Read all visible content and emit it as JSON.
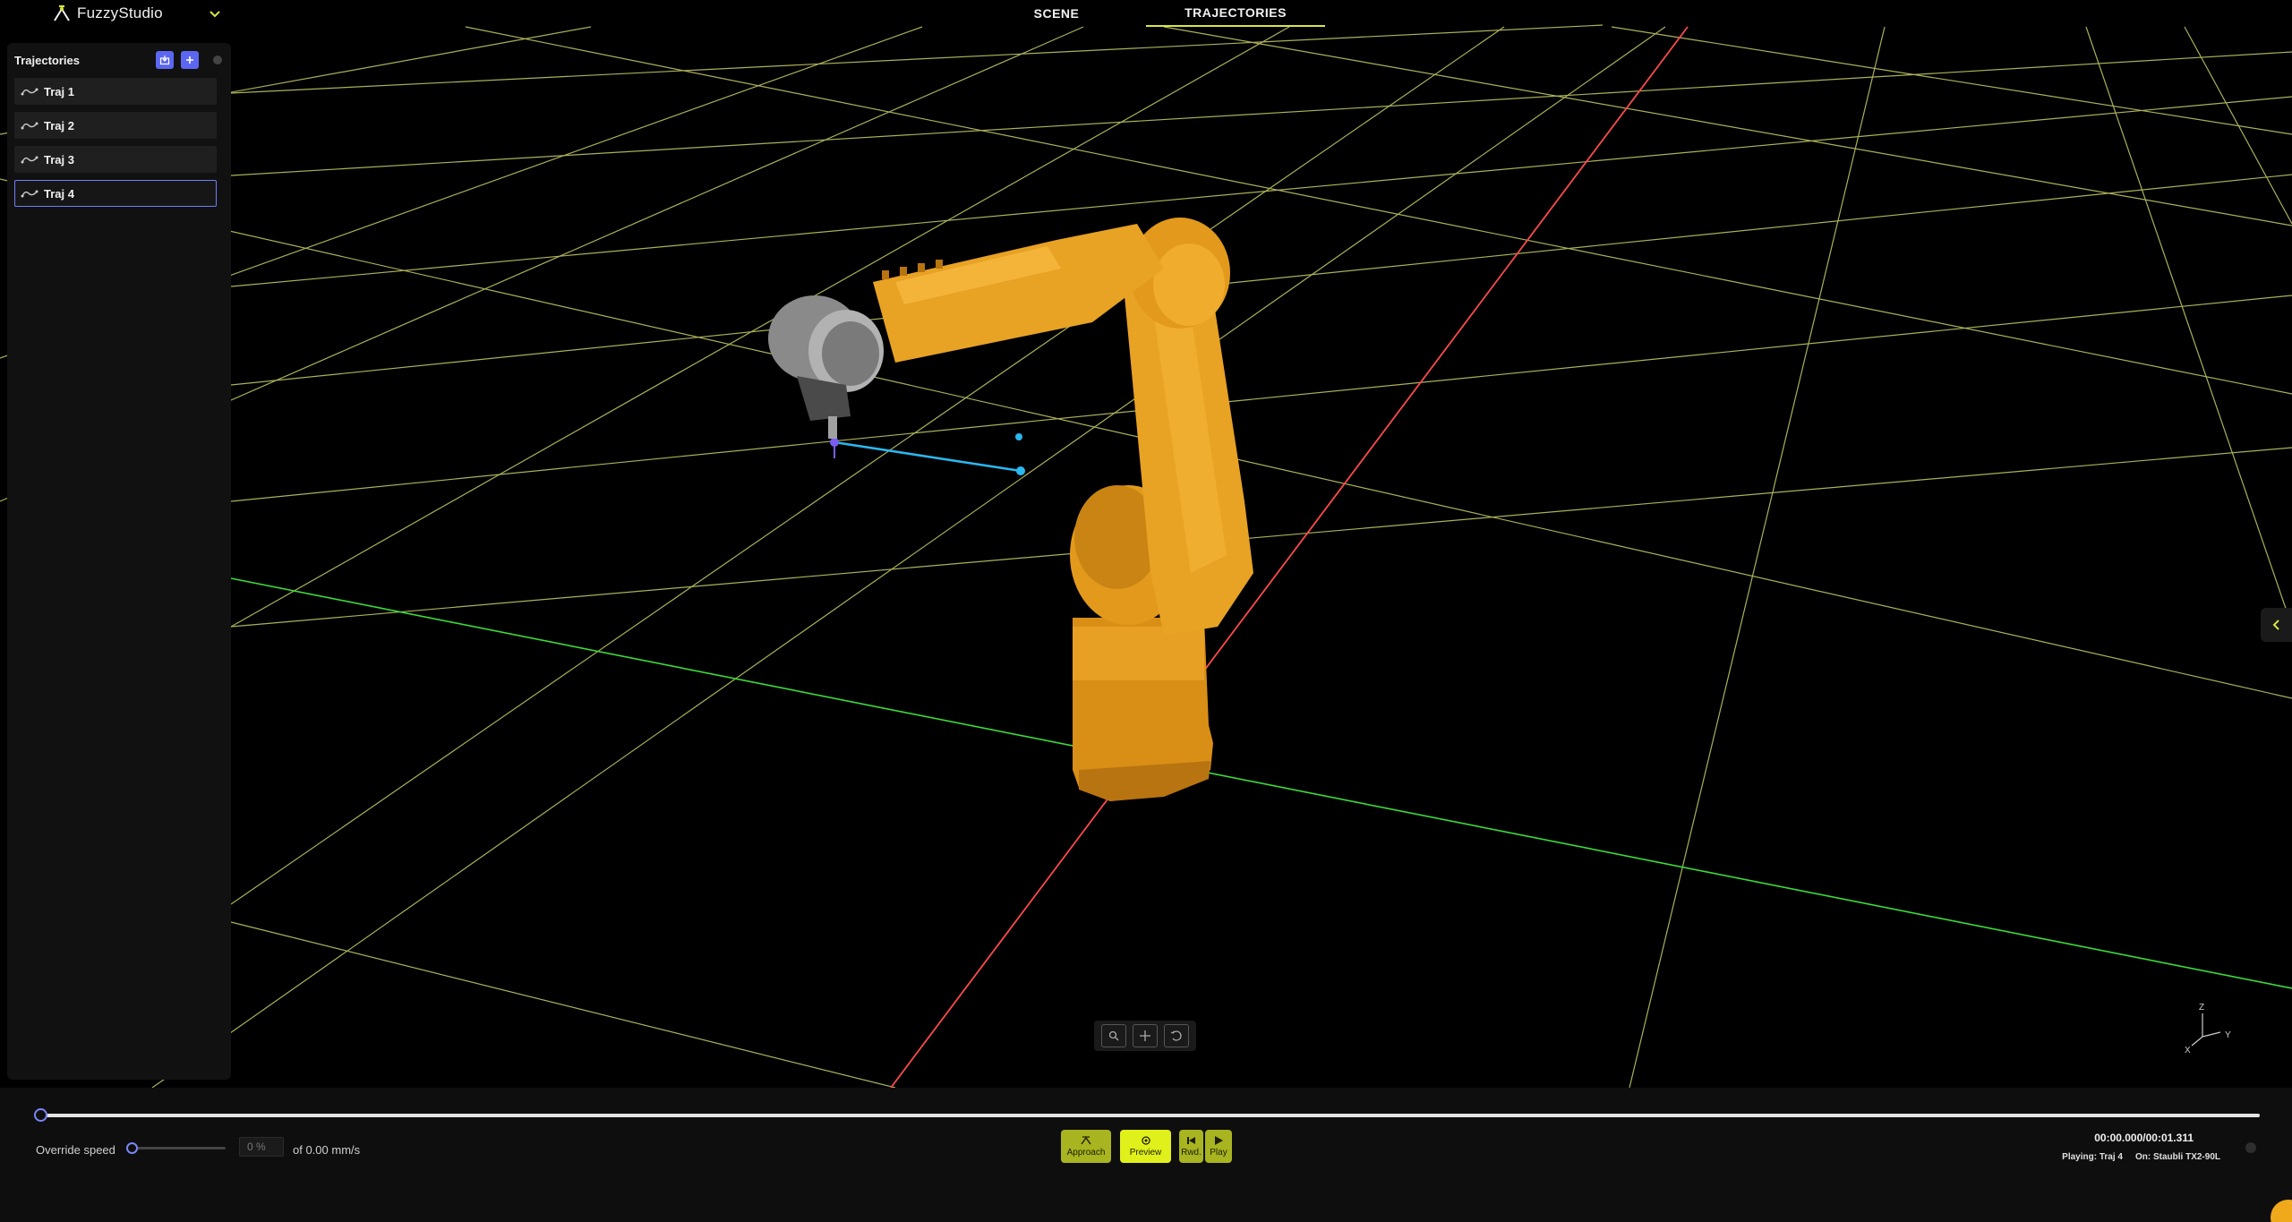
{
  "app": {
    "brand": "FuzzyStudio",
    "accent_color": "#d8e640",
    "selection_color": "#6f7ff7"
  },
  "nav": {
    "tabs": [
      {
        "label": "SCENE",
        "active": false
      },
      {
        "label": "TRAJECTORIES",
        "active": true
      }
    ]
  },
  "sidebar": {
    "title": "Trajectories",
    "buttons": [
      {
        "icon": "import-icon"
      },
      {
        "icon": "add-icon"
      }
    ],
    "items": [
      {
        "label": "Traj 1",
        "selected": false
      },
      {
        "label": "Traj 2",
        "selected": false
      },
      {
        "label": "Traj 3",
        "selected": false
      },
      {
        "label": "Traj 4",
        "selected": true
      }
    ]
  },
  "viewport": {
    "robot_color": "#e39a1c",
    "grid_color": "#c9d06a",
    "x_axis_color": "#ff4a4a",
    "y_axis_color": "#3bdc3b",
    "path_color": "#2ab8f0",
    "tools": [
      {
        "icon": "zoom-icon"
      },
      {
        "icon": "crosshair-icon"
      },
      {
        "icon": "camera-reset-icon"
      }
    ],
    "axis_labels": {
      "z": "Z",
      "y": "Y",
      "x": "X"
    }
  },
  "playback": {
    "progress": 0,
    "override_speed_label": "Override speed",
    "speed_value": 0,
    "speed_placeholder": "0 %",
    "speed_unit": "of 0.00 mm/s",
    "controls": {
      "approach": "Approach",
      "preview": "Preview",
      "rewind": "Rwd.",
      "play": "Play"
    },
    "time": "00:00.000/00:01.311",
    "playing": "Playing: Traj 4",
    "robot": "On: Staubli TX2-90L"
  }
}
